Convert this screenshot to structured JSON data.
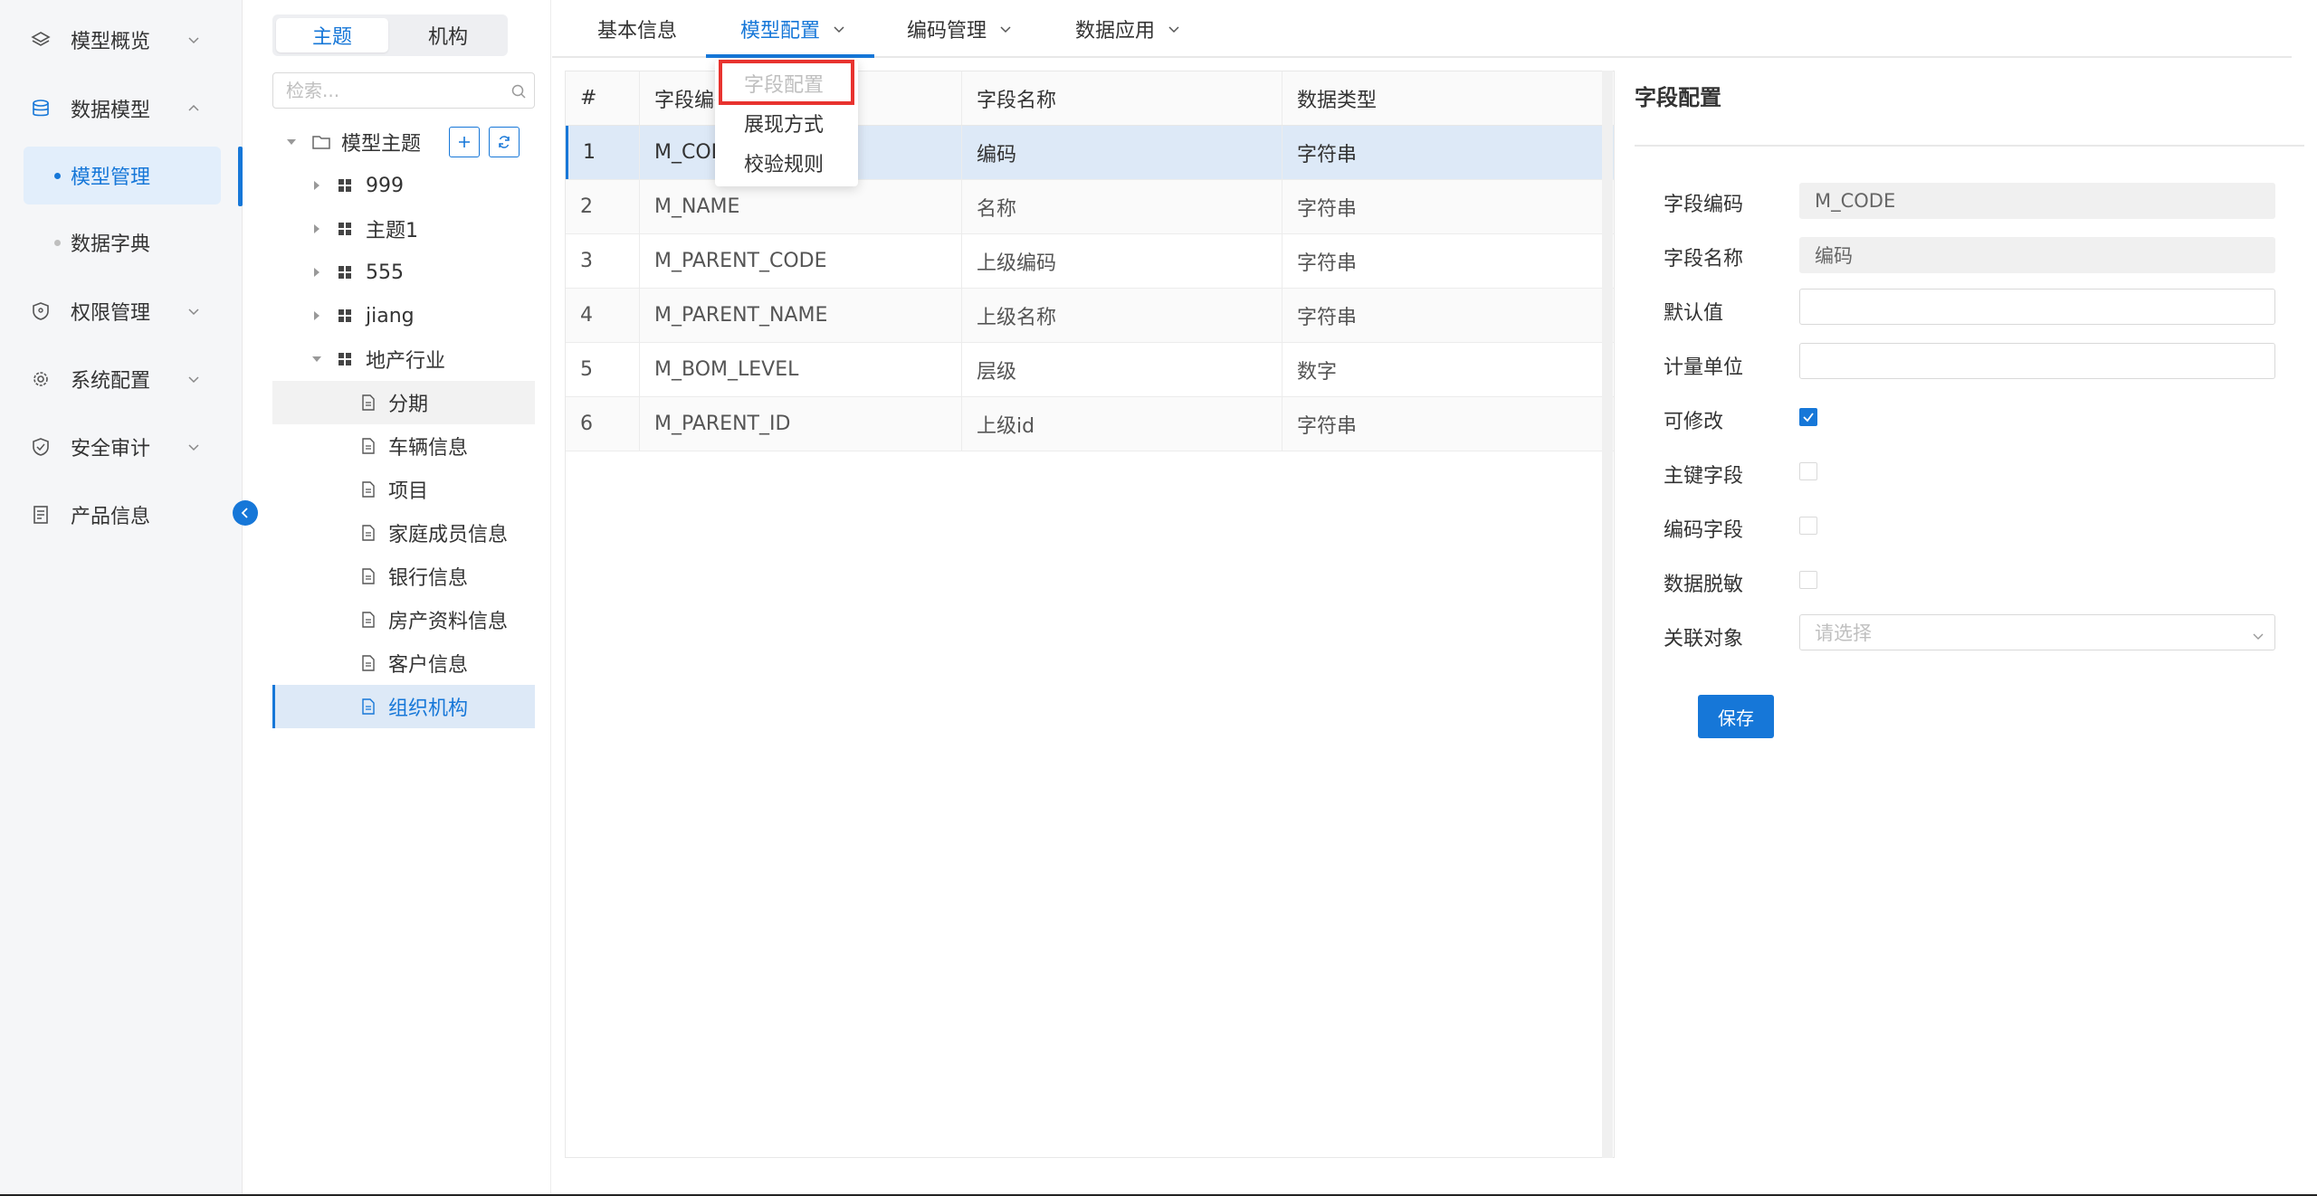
{
  "nav": {
    "items": [
      {
        "label": "模型概览",
        "icon": "layers-icon"
      },
      {
        "label": "数据模型",
        "icon": "database-icon"
      },
      {
        "label": "权限管理",
        "icon": "shield-icon"
      },
      {
        "label": "系统配置",
        "icon": "gear-icon"
      },
      {
        "label": "安全审计",
        "icon": "audit-icon"
      },
      {
        "label": "产品信息",
        "icon": "document-icon"
      }
    ],
    "sub_items": [
      {
        "label": "模型管理"
      },
      {
        "label": "数据字典"
      }
    ]
  },
  "tree": {
    "seg_tabs": [
      "主题",
      "机构"
    ],
    "search_placeholder": "检索...",
    "root": "模型主题",
    "nodes": [
      "999",
      "主题1",
      "555",
      "jiang",
      "地产行业"
    ],
    "leaves": [
      "分期",
      "车辆信息",
      "项目",
      "家庭成员信息",
      "银行信息",
      "房产资料信息",
      "客户信息",
      "组织机构"
    ]
  },
  "tabs": [
    "基本信息",
    "模型配置",
    "编码管理",
    "数据应用"
  ],
  "dropdown": [
    "字段配置",
    "展现方式",
    "校验规则"
  ],
  "table": {
    "headers": [
      "#",
      "字段编码",
      "字段名称",
      "数据类型"
    ],
    "rows": [
      [
        "1",
        "M_CODE",
        "编码",
        "字符串"
      ],
      [
        "2",
        "M_NAME",
        "名称",
        "字符串"
      ],
      [
        "3",
        "M_PARENT_CODE",
        "上级编码",
        "字符串"
      ],
      [
        "4",
        "M_PARENT_NAME",
        "上级名称",
        "字符串"
      ],
      [
        "5",
        "M_BOM_LEVEL",
        "层级",
        "数字"
      ],
      [
        "6",
        "M_PARENT_ID",
        "上级id",
        "字符串"
      ]
    ]
  },
  "form": {
    "title": "字段配置",
    "labels": {
      "code": "字段编码",
      "name": "字段名称",
      "default": "默认值",
      "unit": "计量单位",
      "editable": "可修改",
      "primary": "主键字段",
      "code_field": "编码字段",
      "mask": "数据脱敏",
      "relation": "关联对象"
    },
    "values": {
      "code": "M_CODE",
      "name": "编码"
    },
    "relation_placeholder": "请选择",
    "save_label": "保存"
  },
  "colors": {
    "accent": "#1677d8",
    "highlight_box": "#e8332f"
  }
}
